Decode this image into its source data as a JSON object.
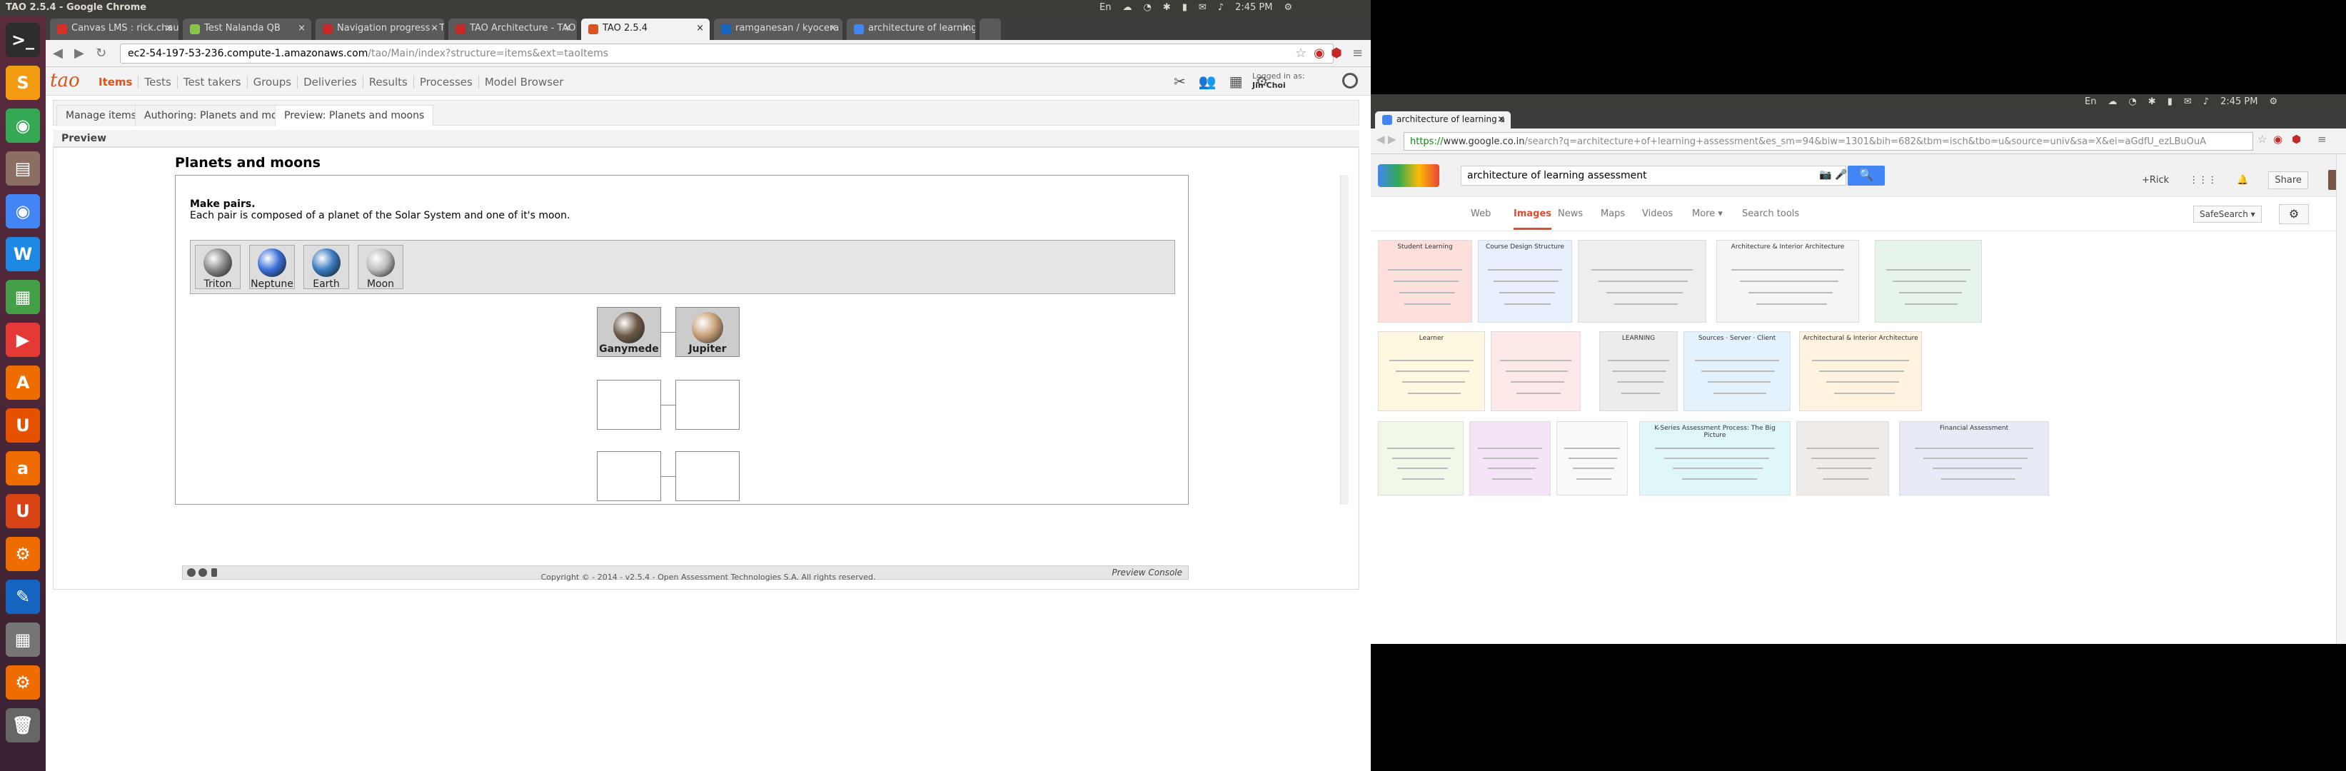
{
  "left": {
    "window_title": "TAO 2.5.4 - Google Chrome",
    "tray": [
      "En",
      "2:45 PM"
    ],
    "launcher": [
      {
        "name": "terminal-icon",
        "glyph": ">_",
        "color": "#2d2d2d"
      },
      {
        "name": "sublime-icon",
        "glyph": "S",
        "color": "#f39c12"
      },
      {
        "name": "chrome-icon",
        "glyph": "◉",
        "color": "#34a853"
      },
      {
        "name": "files-icon",
        "glyph": "▤",
        "color": "#8d6e63"
      },
      {
        "name": "chromium-icon",
        "glyph": "◉",
        "color": "#4285f4"
      },
      {
        "name": "writer-icon",
        "glyph": "W",
        "color": "#1e88e5"
      },
      {
        "name": "calc-icon",
        "glyph": "▦",
        "color": "#43a047"
      },
      {
        "name": "impress-icon",
        "glyph": "▶",
        "color": "#e53935"
      },
      {
        "name": "software-center-icon",
        "glyph": "A",
        "color": "#ef6c00"
      },
      {
        "name": "ubuntu-one-icon",
        "glyph": "U",
        "color": "#e65100"
      },
      {
        "name": "amazon-icon",
        "glyph": "a",
        "color": "#ef6c00"
      },
      {
        "name": "ubuntu-one-music-icon",
        "glyph": "U",
        "color": "#d84315"
      },
      {
        "name": "settings-icon",
        "glyph": "⚙",
        "color": "#ef6c00"
      },
      {
        "name": "texmaker-icon",
        "glyph": "✎",
        "color": "#1565c0"
      },
      {
        "name": "workspaces-icon",
        "glyph": "▦",
        "color": "#757575"
      },
      {
        "name": "updater-icon",
        "glyph": "⚙",
        "color": "#ef6c00"
      },
      {
        "name": "trash-icon",
        "glyph": "🗑",
        "color": "#666"
      }
    ],
    "tabs": [
      {
        "label": "Canvas LMS : rick.chauha",
        "fav": "#d93025"
      },
      {
        "label": "Test Nalanda QB",
        "fav": "#8bc34a"
      },
      {
        "label": "Navigation progress - TA",
        "fav": "#c62828"
      },
      {
        "label": "TAO Architecture - TAO -",
        "fav": "#c62828"
      },
      {
        "label": "TAO 2.5.4",
        "fav": "#d9541e",
        "active": true
      },
      {
        "label": "ramganesan / kyocera —",
        "fav": "#1565c0"
      },
      {
        "label": "architecture of learning a",
        "fav": "#4285f4"
      }
    ],
    "url_host": "ec2-54-197-53-236.compute-1.amazonaws.com",
    "url_path": "/tao/Main/index?structure=items&ext=taoItems",
    "nav": [
      "Items",
      "Tests",
      "Test takers",
      "Groups",
      "Deliveries",
      "Results",
      "Processes",
      "Model Browser"
    ],
    "logged_in_label": "Logged in as:",
    "logged_in_user": "Jin Choi",
    "subtabs": [
      "Manage items",
      "Authoring: Planets and moons",
      "Preview: Planets and moons"
    ],
    "preview_label": "Preview",
    "item_title": "Planets and moons",
    "prompt_title": "Make pairs.",
    "prompt_text": "Each pair is composed of a planet of the Solar System and one of it's moon.",
    "choices": [
      {
        "label": "Triton",
        "color": "#8a8a8a"
      },
      {
        "label": "Neptune",
        "color": "#3b6fd6"
      },
      {
        "label": "Earth",
        "color": "#3a7bbf"
      },
      {
        "label": "Moon",
        "color": "#bdbdbd"
      }
    ],
    "pairs": [
      {
        "left": "Ganymede",
        "right": "Jupiter",
        "left_color": "#6d5a48",
        "right_color": "#c9a27a"
      }
    ],
    "console_label": "Preview Console",
    "copyright": "Copyright © - 2014 - v2.5.4 - Open Assessment Technologies S.A. All rights reserved."
  },
  "right": {
    "tray": [
      "En",
      "2:45 PM"
    ],
    "tab_label": "architecture of learning a",
    "url_scheme": "https://",
    "url_host": "www.google.co.in",
    "url_rest": "/search?q=architecture+of+learning+assessment&es_sm=94&biw=1301&bih=682&tbm=isch&tbo=u&source=univ&sa=X&ei=aGdfU_ezLBuOuA",
    "search_query": "architecture of learning assessment",
    "user": "+Rick",
    "share": "Share",
    "tabs": [
      "Web",
      "Images",
      "News",
      "Maps",
      "Videos",
      "More ▾",
      "Search tools"
    ],
    "active_tab": "Images",
    "safesearch": "SafeSearch ▾",
    "thumbs": [
      {
        "cap": "Student Learning"
      },
      {
        "cap": "Course Design Structure"
      },
      {
        "cap": ""
      },
      {
        "cap": "Architecture & Interior Architecture"
      },
      {
        "cap": ""
      },
      {
        "cap": "Learner"
      },
      {
        "cap": ""
      },
      {
        "cap": "LEARNING"
      },
      {
        "cap": "Sources · Server · Client"
      },
      {
        "cap": "Architectural & Interior Architecture"
      },
      {
        "cap": ""
      },
      {
        "cap": ""
      },
      {
        "cap": ""
      },
      {
        "cap": "K-Series Assessment Process: The Big Picture"
      },
      {
        "cap": ""
      },
      {
        "cap": "Financial Assessment"
      }
    ]
  }
}
